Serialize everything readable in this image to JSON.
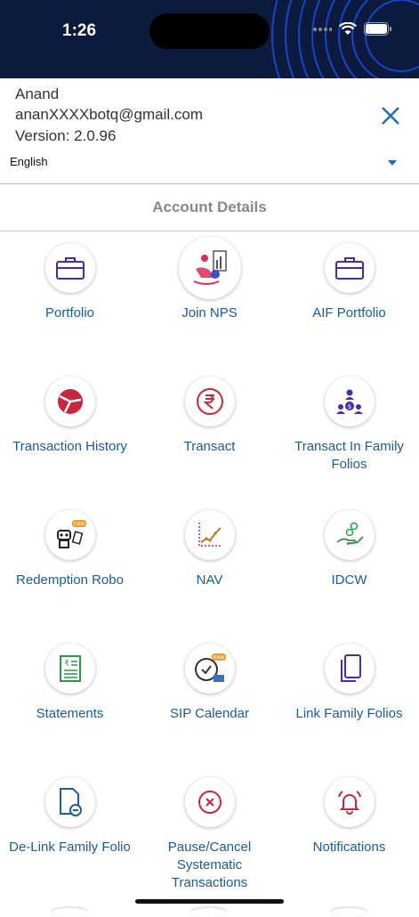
{
  "status": {
    "time": "1:26"
  },
  "profile": {
    "name": "Anand",
    "email": "ananXXXXbotq@gmail.com",
    "version": "Version: 2.0.96",
    "language": "English"
  },
  "section": {
    "title": "Account Details"
  },
  "tiles": [
    {
      "label": "Portfolio",
      "icon": "briefcase-icon"
    },
    {
      "label": "Join NPS",
      "icon": "retirement-chair-icon"
    },
    {
      "label": "AIF Portfolio",
      "icon": "briefcase-icon"
    },
    {
      "label": "Transaction History",
      "icon": "pie-chart-icon"
    },
    {
      "label": "Transact",
      "icon": "rupee-icon"
    },
    {
      "label": "Transact In Family Folios",
      "icon": "family-money-icon"
    },
    {
      "label": "Redemption Robo",
      "icon": "robot-icon",
      "badge": "new"
    },
    {
      "label": "NAV",
      "icon": "line-chart-icon"
    },
    {
      "label": "IDCW",
      "icon": "hand-coins-icon"
    },
    {
      "label": "Statements",
      "icon": "statement-icon"
    },
    {
      "label": "SIP Calendar",
      "icon": "clock-calendar-icon",
      "badge": "new"
    },
    {
      "label": "Link Family Folios",
      "icon": "copy-icon"
    },
    {
      "label": "De-Link Family Folio",
      "icon": "document-minus-icon"
    },
    {
      "label": "Pause/Cancel Systematic Transactions",
      "icon": "cancel-circle-icon"
    },
    {
      "label": "Notifications",
      "icon": "bell-icon"
    }
  ],
  "colors": {
    "header_bg": "#0b1a3d",
    "label": "#1b5c92",
    "icon_purple": "#4b2aa8",
    "icon_red": "#c8263c",
    "icon_blue": "#1f6fb0"
  }
}
